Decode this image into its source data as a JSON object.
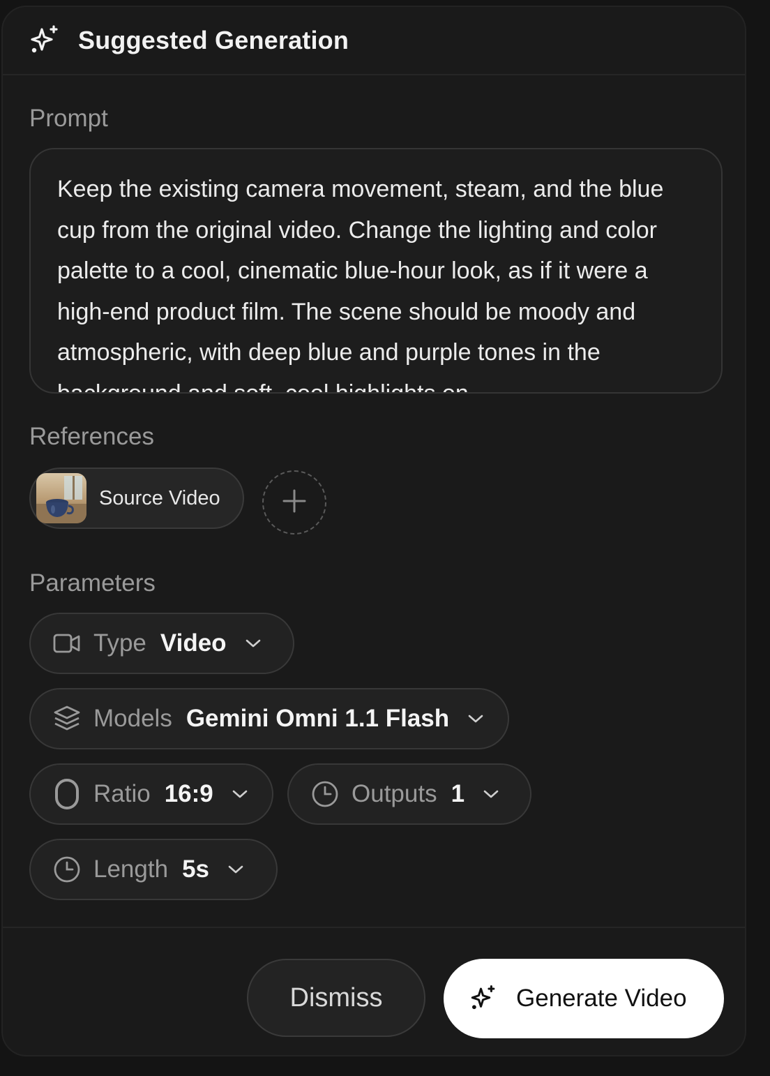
{
  "header": {
    "icon": "sparkles-icon",
    "title": "Suggested Generation"
  },
  "prompt": {
    "label": "Prompt",
    "text": "Keep the existing camera movement, steam, and the blue cup from the original video. Change the lighting and color palette to a cool, cinematic blue-hour look, as if it were a high-end product film. The scene should be moody and atmospheric, with deep blue and purple tones in the background and soft, cool highlights on"
  },
  "references": {
    "label": "References",
    "items": [
      {
        "label": "Source Video",
        "thumbnail": "cup-thumbnail"
      }
    ],
    "add_icon": "plus-icon"
  },
  "parameters": {
    "label": "Parameters",
    "type": {
      "icon": "video-camera-icon",
      "key": "Type",
      "value": "Video"
    },
    "models": {
      "icon": "layers-icon",
      "key": "Models",
      "value": "Gemini Omni 1.1 Flash"
    },
    "ratio": {
      "icon": "ratio-icon",
      "key": "Ratio",
      "value": "16:9"
    },
    "outputs": {
      "icon": "clock-icon",
      "key": "Outputs",
      "value": "1"
    },
    "length": {
      "icon": "clock-icon",
      "key": "Length",
      "value": "5s"
    }
  },
  "actions": {
    "dismiss": "Dismiss",
    "generate": "Generate Video"
  },
  "colors": {
    "background": "#141414",
    "panel": "#1a1a1a",
    "primary_button": "#ffffff"
  }
}
